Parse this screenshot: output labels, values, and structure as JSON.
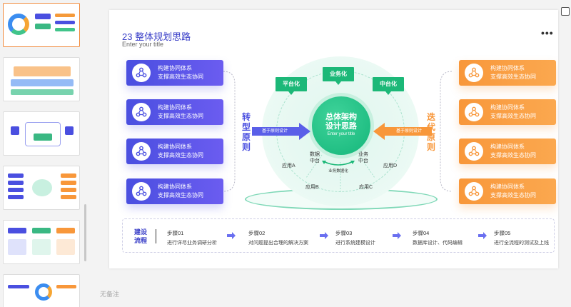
{
  "slide": {
    "title": "23 整体规划思路",
    "subtitle": "Enter your title"
  },
  "left_cards": [
    {
      "line1": "构建协同体系",
      "line2": "支撑高效生态协同"
    },
    {
      "line1": "构建协同体系",
      "line2": "支撑高效生态协同"
    },
    {
      "line1": "构建协同体系",
      "line2": "支撑高效生态协同"
    },
    {
      "line1": "构建协同体系",
      "line2": "支撑高效生态协同"
    }
  ],
  "right_cards": [
    {
      "line1": "构建协同体系",
      "line2": "支撑高效生态协同"
    },
    {
      "line1": "构建协同体系",
      "line2": "支撑高效生态协同"
    },
    {
      "line1": "构建协同体系",
      "line2": "支撑高效生态协同"
    },
    {
      "line1": "构建协同体系",
      "line2": "支撑高效生态协同"
    }
  ],
  "left_label": [
    "转",
    "型",
    "原",
    "则"
  ],
  "right_label": [
    "迭",
    "代",
    "原",
    "则"
  ],
  "diagram": {
    "core_line1": "总体架构",
    "core_line2": "设计思路",
    "core_sub": "Enter your title",
    "bubbles": [
      "平台化",
      "业务化",
      "中台化"
    ],
    "left_arrow": "基于原则设计",
    "right_arrow": "基于原则设计",
    "data_center": [
      "数据",
      "中台"
    ],
    "biz_center": [
      "业务",
      "中台"
    ],
    "shared": "业务数据化",
    "apps": [
      "应用A",
      "应用B",
      "应用C",
      "应用D"
    ]
  },
  "process": {
    "title": [
      "建设",
      "流程"
    ],
    "steps": [
      {
        "name": "步骤01",
        "desc": "进行详尽业务调研分析"
      },
      {
        "name": "步骤02",
        "desc": "对问题提出合理的解决方案"
      },
      {
        "name": "步骤03",
        "desc": "进行系统建模设计"
      },
      {
        "name": "步骤04",
        "desc": "数据库设计、代码编辑"
      },
      {
        "name": "步骤05",
        "desc": "进行全流程的测试及上线"
      }
    ]
  },
  "more_menu": "•••",
  "notes_placeholder": "无备注",
  "colors": {
    "blue": "#4a4fe0",
    "orange": "#f8973a",
    "green": "#1cb878",
    "accent_thumb": "#f08a3c"
  }
}
